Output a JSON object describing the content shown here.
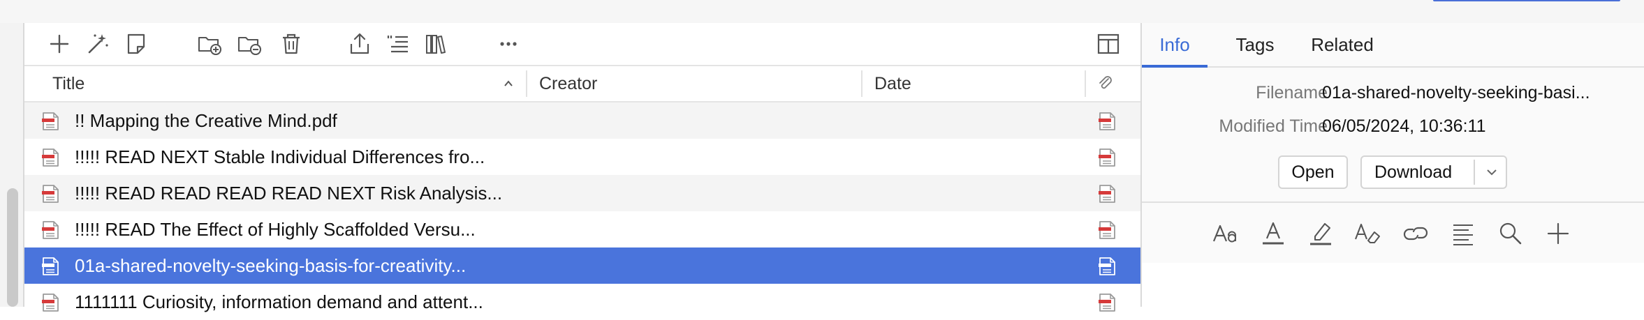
{
  "toolbar": {
    "icons": [
      "new-item-icon",
      "magic-wand-icon",
      "new-note-icon",
      "add-to-collection-icon",
      "remove-from-collection-icon",
      "trash-icon",
      "export-icon",
      "citation-icon",
      "library-icon",
      "more-icon",
      "columns-icon"
    ]
  },
  "columns": {
    "title": "Title",
    "creator": "Creator",
    "date": "Date"
  },
  "rows": [
    {
      "title": "!! Mapping the Creative Mind.pdf",
      "selected": false
    },
    {
      "title": "!!!!! READ NEXT Stable Individual Differences fro...",
      "selected": false
    },
    {
      "title": "!!!!! READ READ READ READ NEXT Risk Analysis...",
      "selected": false
    },
    {
      "title": "!!!!! READ The Effect of Highly Scaffolded Versu...",
      "selected": false
    },
    {
      "title": "01a-shared-novelty-seeking-basis-for-creativity...",
      "selected": true
    },
    {
      "title": "1111111 Curiosity, information demand and attent...",
      "selected": false
    }
  ],
  "right_pane": {
    "tabs": [
      "Info",
      "Tags",
      "Related"
    ],
    "active_tab": "Info",
    "filename_label": "Filename",
    "filename_value": "01a-shared-novelty-seeking-basi...",
    "modified_label": "Modified Time",
    "modified_value": "06/05/2024, 10:36:11",
    "open_button": "Open",
    "download_button": "Download",
    "annotation_tools": [
      "font-size-icon",
      "text-color-icon",
      "highlight-icon",
      "clear-format-icon",
      "link-icon",
      "align-icon",
      "search-icon",
      "add-icon"
    ]
  },
  "colors": {
    "accent": "#3a6bd6",
    "selection": "#4a74dc"
  }
}
